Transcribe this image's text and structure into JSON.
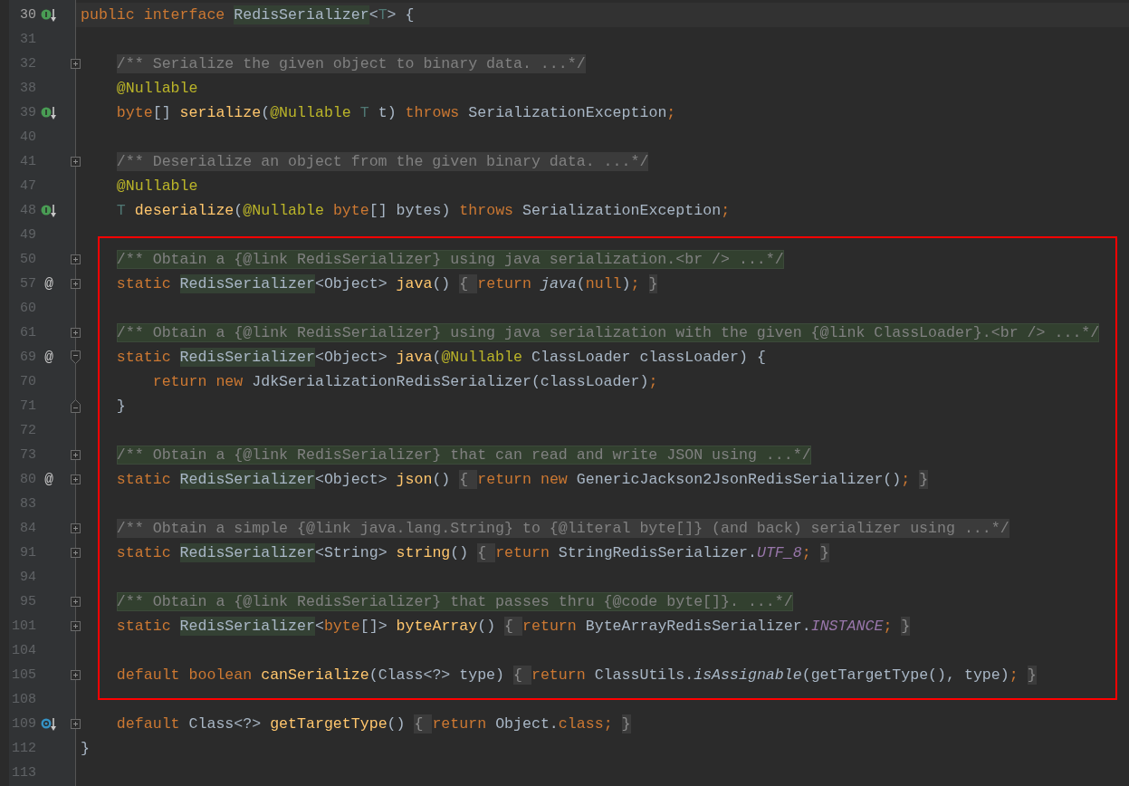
{
  "editor": {
    "sections": [
      {
        "framed": false,
        "lines": [
          {
            "number": "30",
            "current": true,
            "marker": {
              "kind": "implemented"
            },
            "code": [
              {
                "text": "public interface ",
                "kind": "kw"
              },
              {
                "text": "RedisSerializer",
                "kind": "usage"
              },
              {
                "text": "<",
                "kind": "plain"
              },
              {
                "text": "T",
                "kind": "typeparam"
              },
              {
                "text": "> {",
                "kind": "plain"
              }
            ]
          },
          {
            "number": "31",
            "current": false
          },
          {
            "number": "32",
            "current": false,
            "fold": {
              "kind": "plus"
            },
            "code": [
              {
                "text": "    /** Serialize the given object to binary data. ...*/",
                "kind": "folded-comment"
              }
            ]
          },
          {
            "number": "38",
            "current": false,
            "code": [
              {
                "text": "    @Nullable",
                "kind": "annot"
              }
            ]
          },
          {
            "number": "39",
            "current": false,
            "marker": {
              "kind": "implemented"
            },
            "code": [
              {
                "text": "    byte",
                "kind": "kw"
              },
              {
                "text": "[] ",
                "kind": "plain"
              },
              {
                "text": "serialize",
                "kind": "method"
              },
              {
                "text": "(",
                "kind": "plain"
              },
              {
                "text": "@Nullable ",
                "kind": "annot"
              },
              {
                "text": "T",
                "kind": "typeparam"
              },
              {
                "text": " t) ",
                "kind": "plain"
              },
              {
                "text": "throws ",
                "kind": "kw"
              },
              {
                "text": "SerializationException",
                "kind": "plain"
              },
              {
                "text": ";",
                "kind": "kw"
              }
            ]
          },
          {
            "number": "40",
            "current": false
          },
          {
            "number": "41",
            "current": false,
            "fold": {
              "kind": "plus"
            },
            "code": [
              {
                "text": "    /** Deserialize an object from the given binary data. ...*/",
                "kind": "folded-comment"
              }
            ]
          },
          {
            "number": "47",
            "current": false,
            "code": [
              {
                "text": "    @Nullable",
                "kind": "annot"
              }
            ]
          },
          {
            "number": "48",
            "current": false,
            "marker": {
              "kind": "implemented"
            },
            "code": [
              {
                "text": "    T",
                "kind": "typeparam"
              },
              {
                "text": " deserialize",
                "kind": "method"
              },
              {
                "text": "(",
                "kind": "plain"
              },
              {
                "text": "@Nullable ",
                "kind": "annot"
              },
              {
                "text": "byte",
                "kind": "kw"
              },
              {
                "text": "[] bytes) ",
                "kind": "plain"
              },
              {
                "text": "throws ",
                "kind": "kw"
              },
              {
                "text": "SerializationException",
                "kind": "plain"
              },
              {
                "text": ";",
                "kind": "kw"
              }
            ]
          },
          {
            "number": "49",
            "current": false
          }
        ]
      },
      {
        "framed": true,
        "lines": [
          {
            "number": "50",
            "current": false,
            "fold": {
              "kind": "plus"
            },
            "code": [
              {
                "text": "    /** Obtain a {@link RedisSerializer} using java serialization.<br /> ...*/",
                "kind": "usage-comment"
              }
            ]
          },
          {
            "number": "57",
            "current": false,
            "marker": {
              "kind": "glyph",
              "text": "@"
            },
            "fold": {
              "kind": "plus"
            },
            "code": [
              {
                "text": "    static ",
                "kind": "kw"
              },
              {
                "text": "RedisSerializer",
                "kind": "usage"
              },
              {
                "text": "<Object> ",
                "kind": "plain"
              },
              {
                "text": "java",
                "kind": "method"
              },
              {
                "text": "()",
                "kind": "plain"
              },
              {
                "text": " { ",
                "kind": "fold"
              },
              {
                "text": "return ",
                "kind": "kw"
              },
              {
                "text": "java",
                "kind": "italic"
              },
              {
                "text": "(",
                "kind": "plain"
              },
              {
                "text": "null",
                "kind": "kw"
              },
              {
                "text": ")",
                "kind": "plain"
              },
              {
                "text": ";",
                "kind": "kw"
              },
              {
                "text": " }",
                "kind": "fold"
              }
            ]
          },
          {
            "number": "60",
            "current": false
          },
          {
            "number": "61",
            "current": false,
            "fold": {
              "kind": "plus"
            },
            "code": [
              {
                "text": "    /** Obtain a {@link RedisSerializer} using java serialization with the given {@link ClassLoader}.<br /> ...*/",
                "kind": "usage-comment"
              }
            ]
          },
          {
            "number": "69",
            "current": false,
            "marker": {
              "kind": "glyph",
              "text": "@"
            },
            "fold": {
              "kind": "open"
            },
            "code": [
              {
                "text": "    static ",
                "kind": "kw"
              },
              {
                "text": "RedisSerializer",
                "kind": "usage"
              },
              {
                "text": "<Object> ",
                "kind": "plain"
              },
              {
                "text": "java",
                "kind": "method"
              },
              {
                "text": "(",
                "kind": "plain"
              },
              {
                "text": "@Nullable ",
                "kind": "annot"
              },
              {
                "text": "ClassLoader classLoader) {",
                "kind": "plain"
              }
            ]
          },
          {
            "number": "70",
            "current": false,
            "code": [
              {
                "text": "        return new ",
                "kind": "kw"
              },
              {
                "text": "JdkSerializationRedisSerializer(classLoader)",
                "kind": "plain"
              },
              {
                "text": ";",
                "kind": "kw"
              }
            ]
          },
          {
            "number": "71",
            "current": false,
            "fold": {
              "kind": "close"
            },
            "code": [
              {
                "text": "    }",
                "kind": "plain"
              }
            ]
          },
          {
            "number": "72",
            "current": false
          },
          {
            "number": "73",
            "current": false,
            "fold": {
              "kind": "plus"
            },
            "code": [
              {
                "text": "    /** Obtain a {@link RedisSerializer} that can read and write JSON using ...*/",
                "kind": "usage-comment"
              }
            ]
          },
          {
            "number": "80",
            "current": false,
            "marker": {
              "kind": "glyph",
              "text": "@"
            },
            "fold": {
              "kind": "plus"
            },
            "code": [
              {
                "text": "    static ",
                "kind": "kw"
              },
              {
                "text": "RedisSerializer",
                "kind": "usage"
              },
              {
                "text": "<Object> ",
                "kind": "plain"
              },
              {
                "text": "json",
                "kind": "method"
              },
              {
                "text": "()",
                "kind": "plain"
              },
              {
                "text": " { ",
                "kind": "fold"
              },
              {
                "text": "return new ",
                "kind": "kw"
              },
              {
                "text": "GenericJackson2JsonRedisSerializer()",
                "kind": "plain"
              },
              {
                "text": ";",
                "kind": "kw"
              },
              {
                "text": " }",
                "kind": "fold"
              }
            ]
          },
          {
            "number": "83",
            "current": false
          },
          {
            "number": "84",
            "current": false,
            "fold": {
              "kind": "plus"
            },
            "code": [
              {
                "text": "    /** Obtain a simple {@link java.lang.String} to {@literal byte[]} (and back) serializer using ...*/",
                "kind": "folded-comment"
              }
            ]
          },
          {
            "number": "91",
            "current": false,
            "fold": {
              "kind": "plus"
            },
            "code": [
              {
                "text": "    static ",
                "kind": "kw"
              },
              {
                "text": "RedisSerializer",
                "kind": "usage"
              },
              {
                "text": "<String> ",
                "kind": "plain"
              },
              {
                "text": "string",
                "kind": "method"
              },
              {
                "text": "()",
                "kind": "plain"
              },
              {
                "text": " { ",
                "kind": "fold"
              },
              {
                "text": "return ",
                "kind": "kw"
              },
              {
                "text": "StringRedisSerializer.",
                "kind": "plain"
              },
              {
                "text": "UTF_8",
                "kind": "static-field"
              },
              {
                "text": ";",
                "kind": "kw"
              },
              {
                "text": " }",
                "kind": "fold"
              }
            ]
          },
          {
            "number": "94",
            "current": false
          },
          {
            "number": "95",
            "current": false,
            "fold": {
              "kind": "plus"
            },
            "code": [
              {
                "text": "    /** Obtain a {@link RedisSerializer} that passes thru {@code byte[]}. ...*/",
                "kind": "usage-comment"
              }
            ]
          },
          {
            "number": "101",
            "current": false,
            "fold": {
              "kind": "plus"
            },
            "code": [
              {
                "text": "    static ",
                "kind": "kw"
              },
              {
                "text": "RedisSerializer",
                "kind": "usage"
              },
              {
                "text": "<",
                "kind": "plain"
              },
              {
                "text": "byte",
                "kind": "kw"
              },
              {
                "text": "[]> ",
                "kind": "plain"
              },
              {
                "text": "byteArray",
                "kind": "method"
              },
              {
                "text": "()",
                "kind": "plain"
              },
              {
                "text": " { ",
                "kind": "fold"
              },
              {
                "text": "return ",
                "kind": "kw"
              },
              {
                "text": "ByteArrayRedisSerializer.",
                "kind": "plain"
              },
              {
                "text": "INSTANCE",
                "kind": "static-field"
              },
              {
                "text": ";",
                "kind": "kw"
              },
              {
                "text": " }",
                "kind": "fold"
              }
            ]
          },
          {
            "number": "104",
            "current": false
          },
          {
            "number": "105",
            "current": false,
            "fold": {
              "kind": "plus"
            },
            "code": [
              {
                "text": "    default boolean ",
                "kind": "kw"
              },
              {
                "text": "canSerialize",
                "kind": "method"
              },
              {
                "text": "(Class<?> type)",
                "kind": "plain"
              },
              {
                "text": " { ",
                "kind": "fold"
              },
              {
                "text": "return ",
                "kind": "kw"
              },
              {
                "text": "ClassUtils.",
                "kind": "plain"
              },
              {
                "text": "isAssignable",
                "kind": "italic"
              },
              {
                "text": "(getTargetType(), type)",
                "kind": "plain"
              },
              {
                "text": ";",
                "kind": "kw"
              },
              {
                "text": " }",
                "kind": "fold"
              }
            ]
          }
        ]
      },
      {
        "framed": false,
        "lines": [
          {
            "number": "108",
            "current": false
          },
          {
            "number": "109",
            "current": false,
            "marker": {
              "kind": "implemented-default"
            },
            "fold": {
              "kind": "plus"
            },
            "code": [
              {
                "text": "    default ",
                "kind": "kw"
              },
              {
                "text": "Class<?> ",
                "kind": "plain"
              },
              {
                "text": "getTargetType",
                "kind": "method"
              },
              {
                "text": "()",
                "kind": "plain"
              },
              {
                "text": " { ",
                "kind": "fold"
              },
              {
                "text": "return ",
                "kind": "kw"
              },
              {
                "text": "Object.",
                "kind": "plain"
              },
              {
                "text": "class",
                "kind": "kw"
              },
              {
                "text": ";",
                "kind": "kw"
              },
              {
                "text": " }",
                "kind": "fold"
              }
            ]
          },
          {
            "number": "112",
            "current": false,
            "code": [
              {
                "text": "}",
                "kind": "plain"
              }
            ]
          },
          {
            "number": "113",
            "current": false
          }
        ]
      }
    ]
  }
}
